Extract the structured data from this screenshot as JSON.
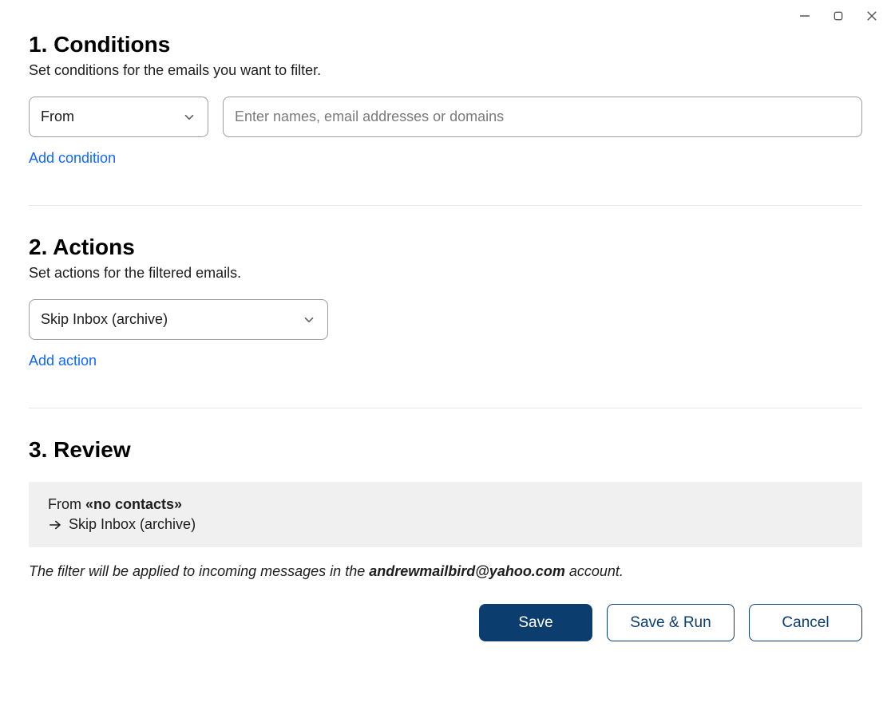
{
  "window": {
    "minimize": "−",
    "maximize": "□",
    "close": "×"
  },
  "conditions": {
    "title": "1. Conditions",
    "subtitle": "Set conditions for the emails you want to filter.",
    "select_value": "From",
    "input_placeholder": "Enter names, email addresses or domains",
    "add_label": "Add condition"
  },
  "actions": {
    "title": "2. Actions",
    "subtitle": "Set actions for the filtered emails.",
    "select_value": "Skip Inbox (archive)",
    "add_label": "Add action"
  },
  "review": {
    "title": "3. Review",
    "summary_from_label": "From ",
    "summary_from_value": "«no contacts»",
    "summary_action": "Skip Inbox (archive)",
    "note_prefix": "The filter will be applied to incoming messages in the ",
    "note_account": "andrewmailbird@yahoo.com",
    "note_suffix": " account."
  },
  "buttons": {
    "save": "Save",
    "save_run": "Save & Run",
    "cancel": "Cancel"
  }
}
